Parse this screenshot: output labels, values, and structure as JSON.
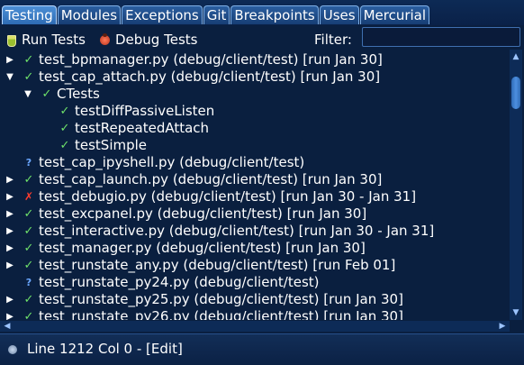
{
  "tabs": [
    {
      "label": "Testing",
      "active": true
    },
    {
      "label": "Modules",
      "active": false
    },
    {
      "label": "Exceptions",
      "active": false
    },
    {
      "label": "Git",
      "active": false
    },
    {
      "label": "Breakpoints",
      "active": false
    },
    {
      "label": "Uses",
      "active": false
    },
    {
      "label": "Mercurial",
      "active": false
    }
  ],
  "toolbar": {
    "run_tests_label": "Run Tests",
    "debug_tests_label": "Debug Tests",
    "filter_label": "Filter:",
    "filter_value": ""
  },
  "tree": [
    {
      "expander": "collapsed",
      "status": "pass",
      "level": 0,
      "label": "test_bpmanager.py (debug/client/test) [run Jan 30]"
    },
    {
      "expander": "expanded",
      "status": "pass",
      "level": 0,
      "label": "test_cap_attach.py (debug/client/test) [run Jan 30]"
    },
    {
      "expander": "expanded",
      "status": "pass",
      "level": 1,
      "label": "CTests"
    },
    {
      "expander": "none",
      "status": "pass",
      "level": 2,
      "label": "testDiffPassiveListen"
    },
    {
      "expander": "none",
      "status": "pass",
      "level": 2,
      "label": "testRepeatedAttach"
    },
    {
      "expander": "none",
      "status": "pass",
      "level": 2,
      "label": "testSimple"
    },
    {
      "expander": "none",
      "status": "unknown",
      "level": 0,
      "label": "test_cap_ipyshell.py (debug/client/test)"
    },
    {
      "expander": "collapsed",
      "status": "pass",
      "level": 0,
      "label": "test_cap_launch.py (debug/client/test) [run Jan 30]"
    },
    {
      "expander": "collapsed",
      "status": "fail",
      "level": 0,
      "label": "test_debugio.py (debug/client/test) [run Jan 30 - Jan 31]"
    },
    {
      "expander": "collapsed",
      "status": "pass",
      "level": 0,
      "label": "test_excpanel.py (debug/client/test) [run Jan 30]"
    },
    {
      "expander": "collapsed",
      "status": "pass",
      "level": 0,
      "label": "test_interactive.py (debug/client/test) [run Jan 30 - Jan 31]"
    },
    {
      "expander": "collapsed",
      "status": "pass",
      "level": 0,
      "label": "test_manager.py (debug/client/test) [run Jan 30]"
    },
    {
      "expander": "collapsed",
      "status": "pass",
      "level": 0,
      "label": "test_runstate_any.py (debug/client/test) [run Feb 01]"
    },
    {
      "expander": "none",
      "status": "unknown",
      "level": 0,
      "label": "test_runstate_py24.py (debug/client/test)"
    },
    {
      "expander": "collapsed",
      "status": "pass",
      "level": 0,
      "label": "test_runstate_py25.py (debug/client/test) [run Jan 30]"
    },
    {
      "expander": "collapsed",
      "status": "pass",
      "level": 0,
      "label": "test_runstate_py26.py (debug/client/test) [run Jan 30]"
    }
  ],
  "status_bar": {
    "text": "Line 1212 Col 0 - [Edit]"
  },
  "icons": {
    "collapsed": "triangle-right",
    "expanded": "triangle-down",
    "pass": "checkmark",
    "fail": "x-mark",
    "unknown": "question-mark"
  },
  "colors": {
    "background": "#0a1f3f",
    "pass": "#6fe16a",
    "fail": "#ff3c2e",
    "unknown": "#6aa7ff",
    "tab_active": "#2e6cb4"
  }
}
